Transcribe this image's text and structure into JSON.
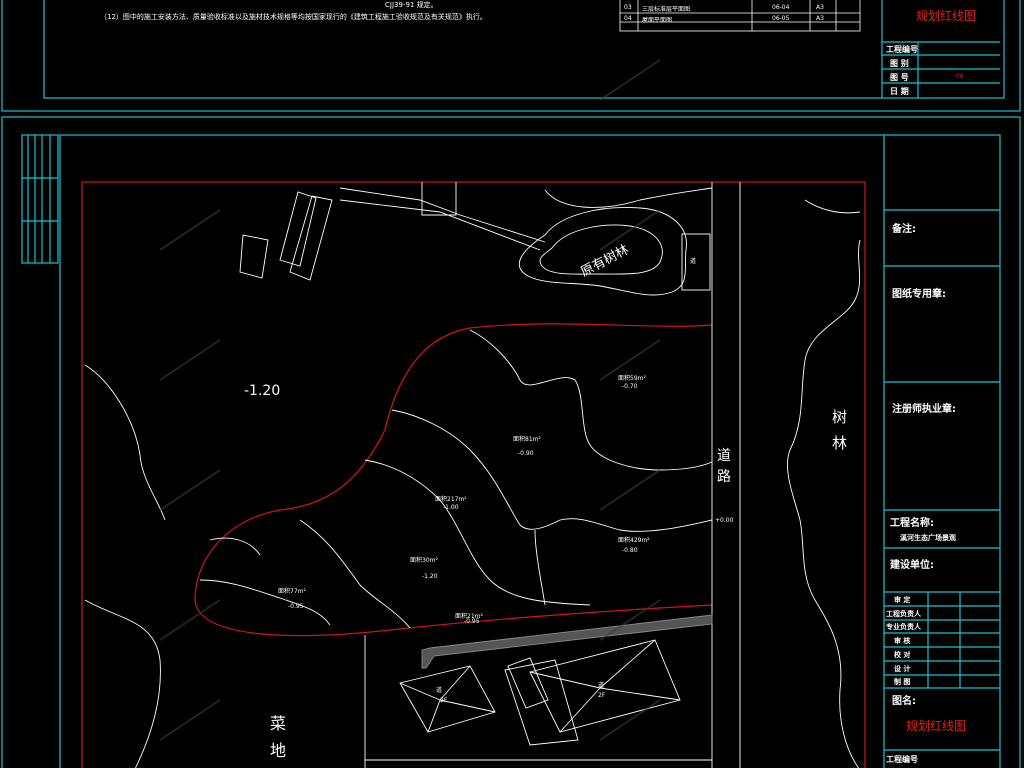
{
  "top_notes": {
    "line1_tail": "CJJ39-91",
    "line1_end": "规定。",
    "line2": "（12）图中的施工安装方法、质量验收标准以及施材技术规格等均按国家现行的《建筑工程施工验收规范及有关规范》执行。"
  },
  "top_sheet_list": {
    "rows": [
      {
        "no": "03",
        "name": "三层标准层平面图",
        "code": "06-04",
        "size": "A3"
      },
      {
        "no": "04",
        "name": "屋面平面图",
        "code": "06-05",
        "size": "A3"
      }
    ]
  },
  "top_title_block": {
    "drawing_name": "规划红线图",
    "rows": [
      {
        "label": "工程编号",
        "value": ""
      },
      {
        "label": "图 别",
        "value": ""
      },
      {
        "label": "图 号",
        "value": "06"
      },
      {
        "label": "日 期",
        "value": ""
      }
    ]
  },
  "plan": {
    "forest_label": "原有树林",
    "building_tag": "道",
    "elev_west": "-1.20",
    "road_label_1": "道",
    "road_label_2": "路",
    "road_elev": "+0.00",
    "trees_label_1": "树",
    "trees_label_2": "林",
    "veg_label_1": "菜",
    "veg_label_2": "地",
    "zones": [
      {
        "area": "面积59m²",
        "elev": "-0.70"
      },
      {
        "area": "面积81m²",
        "elev": "-0.90"
      },
      {
        "area": "面积217m²",
        "elev": "-1.00"
      },
      {
        "area": "面积30m²",
        "elev": "-1.20"
      },
      {
        "area": "面积429m²",
        "elev": "-0.80"
      },
      {
        "area": "面积77m²",
        "elev": "-0.95"
      },
      {
        "area": "面积21m²",
        "elev": "-0.95"
      }
    ],
    "house_a": {
      "tag": "道",
      "floors": "2F"
    },
    "house_b": {
      "tag": "道",
      "floors": "2F"
    }
  },
  "title_block": {
    "notes_label": "备注:",
    "seal_label": "图纸专用章:",
    "cert_label": "注册师执业章:",
    "project_label": "工程名称:",
    "project_value": "溪河生态广场景观",
    "client_label": "建设单位:",
    "sign_rows": [
      "审 定",
      "工程负责人",
      "专业负责人",
      "审 核",
      "校 对",
      "设 计",
      "制 图"
    ],
    "drawing_label": "图名:",
    "drawing_value": "规划红线图",
    "number_label": "工程编号"
  },
  "colors": {
    "frame": "#17c3d0",
    "redline": "#d3131c",
    "lines": "#ffffff",
    "background": "#000000"
  }
}
